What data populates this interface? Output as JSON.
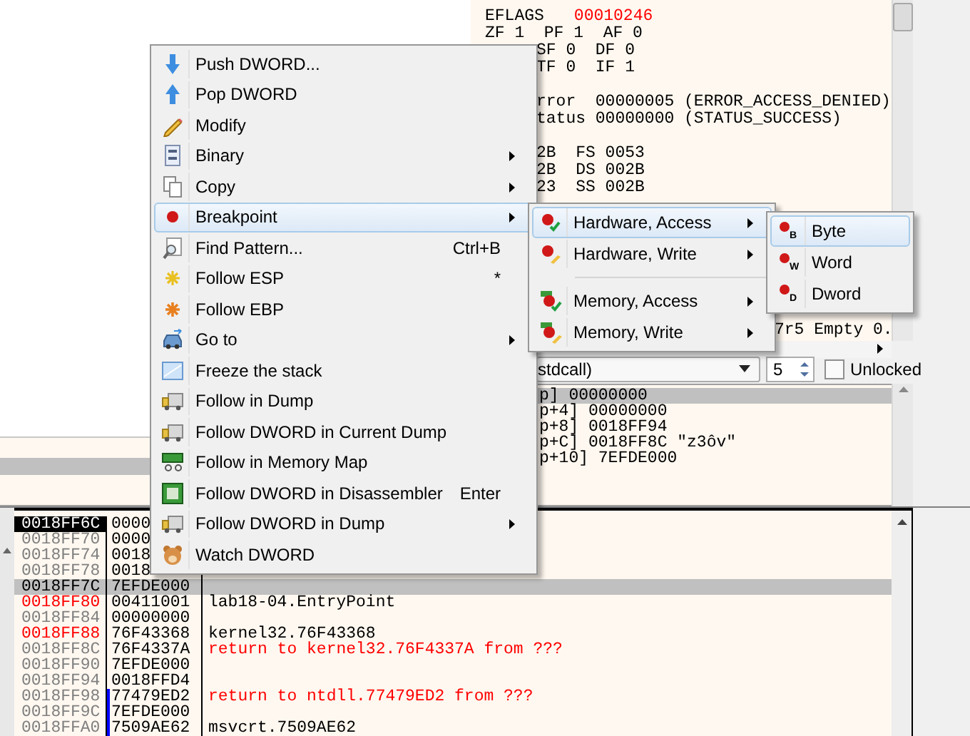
{
  "registers": {
    "groups": [
      [
        {
          "kind": "full",
          "text": "EFLAGS",
          "value": "00010246"
        },
        {
          "kind": "full",
          "text": "ZF 1  PF 1  AF 0"
        },
        {
          "kind": "clipped",
          "text": "SF 0  DF 0"
        },
        {
          "kind": "clipped",
          "text": "TF 0  IF 1"
        }
      ],
      [
        {
          "kind": "clipped",
          "text": "rror  00000005 (ERROR_ACCESS_DENIED)"
        },
        {
          "kind": "clipped",
          "text": "tatus 00000000 (STATUS_SUCCESS)"
        }
      ],
      [
        {
          "kind": "clipped",
          "text": "2B  FS 0053"
        },
        {
          "kind": "clipped",
          "text": "2B  DS 002B"
        },
        {
          "kind": "clipped",
          "text": "23  SS 002B"
        }
      ],
      [
        {
          "kind": "far",
          "text": "7r5 Empty 0."
        }
      ]
    ]
  },
  "toolbar": {
    "convention": "stdcall)",
    "arg_count": "5",
    "unlocked": {
      "label": "Unlocked",
      "checked": false
    }
  },
  "arguments": [
    {
      "text": "p] 00000000",
      "selected": true
    },
    {
      "text": "p+4] 00000000",
      "selected": false
    },
    {
      "text": "p+8] 0018FF94",
      "selected": false
    },
    {
      "text": "p+C] 0018FF8C \"z3ôv\"",
      "selected": false
    },
    {
      "text": "p+10] 7EFDE000",
      "selected": false
    }
  ],
  "stack": [
    {
      "address": "0018FF6C",
      "kind": "current",
      "current": true,
      "selected": false,
      "bracket": false,
      "value": "0000"
    },
    {
      "address": "0018FF70",
      "kind": "plain",
      "current": false,
      "selected": false,
      "bracket": false,
      "value": "0000"
    },
    {
      "address": "0018FF74",
      "kind": "plain",
      "current": false,
      "selected": false,
      "bracket": false,
      "value": "0018"
    },
    {
      "address": "0018FF78",
      "kind": "plain",
      "current": false,
      "selected": false,
      "bracket": false,
      "value": "0018"
    },
    {
      "address": "0018FF7C",
      "kind": "plain",
      "current": false,
      "selected": true,
      "bracket": false,
      "value": "7EFDE000"
    },
    {
      "address": "0018FF80",
      "kind": "changed",
      "current": false,
      "selected": false,
      "bracket": false,
      "value": "00411001",
      "comment": "lab18-04.EntryPoint",
      "warning": false
    },
    {
      "address": "0018FF84",
      "kind": "plain",
      "current": false,
      "selected": false,
      "bracket": false,
      "value": "00000000"
    },
    {
      "address": "0018FF88",
      "kind": "changed",
      "current": false,
      "selected": false,
      "bracket": false,
      "value": "76F43368",
      "comment": "kernel32.76F43368",
      "warning": false
    },
    {
      "address": "0018FF8C",
      "kind": "plain",
      "current": false,
      "selected": false,
      "bracket": false,
      "value": "76F4337A",
      "comment": "return to kernel32.76F4337A from ???",
      "warning": true
    },
    {
      "address": "0018FF90",
      "kind": "plain",
      "current": false,
      "selected": false,
      "bracket": false,
      "value": "7EFDE000"
    },
    {
      "address": "0018FF94",
      "kind": "plain",
      "current": false,
      "selected": false,
      "bracket": false,
      "value": "0018FFD4"
    },
    {
      "address": "0018FF98",
      "kind": "plain",
      "current": false,
      "selected": false,
      "bracket": true,
      "value": "77479ED2",
      "comment": "return to ntdll.77479ED2 from ???",
      "warning": true
    },
    {
      "address": "0018FF9C",
      "kind": "plain",
      "current": false,
      "selected": false,
      "bracket": true,
      "value": "7EFDE000"
    },
    {
      "address": "0018FFA0",
      "kind": "plain",
      "current": false,
      "selected": false,
      "bracket": true,
      "value": "7509AE62",
      "comment": "msvcrt.7509AE62",
      "warning": false
    }
  ],
  "menu": {
    "items": [
      {
        "label": "Push DWORD...",
        "selected": false,
        "submenu": false
      },
      {
        "label": "Pop DWORD",
        "selected": false,
        "submenu": false
      },
      {
        "label": "Modify",
        "selected": false,
        "submenu": false
      },
      {
        "label": "Binary",
        "selected": false,
        "submenu": true
      },
      {
        "label": "Copy",
        "selected": false,
        "submenu": true
      },
      {
        "label": "Breakpoint",
        "selected": true,
        "submenu": true
      },
      {
        "label": "Find Pattern...",
        "shortcut": "Ctrl+B",
        "selected": false,
        "submenu": false
      },
      {
        "label": "Follow ESP",
        "shortcut": "*",
        "selected": false,
        "submenu": false
      },
      {
        "label": "Follow EBP",
        "selected": false,
        "submenu": false
      },
      {
        "label": "Go to",
        "selected": false,
        "submenu": true
      },
      {
        "label": "Freeze the stack",
        "selected": false,
        "submenu": false
      },
      {
        "label": "Follow in Dump",
        "selected": false,
        "submenu": false
      },
      {
        "label": "Follow DWORD in Current Dump",
        "selected": false,
        "submenu": false
      },
      {
        "label": "Follow in Memory Map",
        "selected": false,
        "submenu": false
      },
      {
        "label": "Follow DWORD in Disassembler",
        "shortcut": "Enter",
        "selected": false,
        "submenu": false
      },
      {
        "label": "Follow DWORD in Dump",
        "selected": false,
        "submenu": true
      },
      {
        "label": "Watch DWORD",
        "selected": false,
        "submenu": false
      }
    ]
  },
  "breakpoint_menu": {
    "groups": [
      [
        {
          "label": "Hardware, Access",
          "selected": true,
          "submenu": true
        },
        {
          "label": "Hardware, Write",
          "selected": false,
          "submenu": true
        }
      ],
      [
        {
          "label": "Memory, Access",
          "selected": false,
          "submenu": true
        },
        {
          "label": "Memory, Write",
          "selected": false,
          "submenu": true
        }
      ]
    ]
  },
  "size_menu": {
    "items": [
      {
        "label": "Byte",
        "mark": "B",
        "selected": true
      },
      {
        "label": "Word",
        "mark": "W",
        "selected": false
      },
      {
        "label": "Dword",
        "mark": "D",
        "selected": false
      }
    ]
  }
}
